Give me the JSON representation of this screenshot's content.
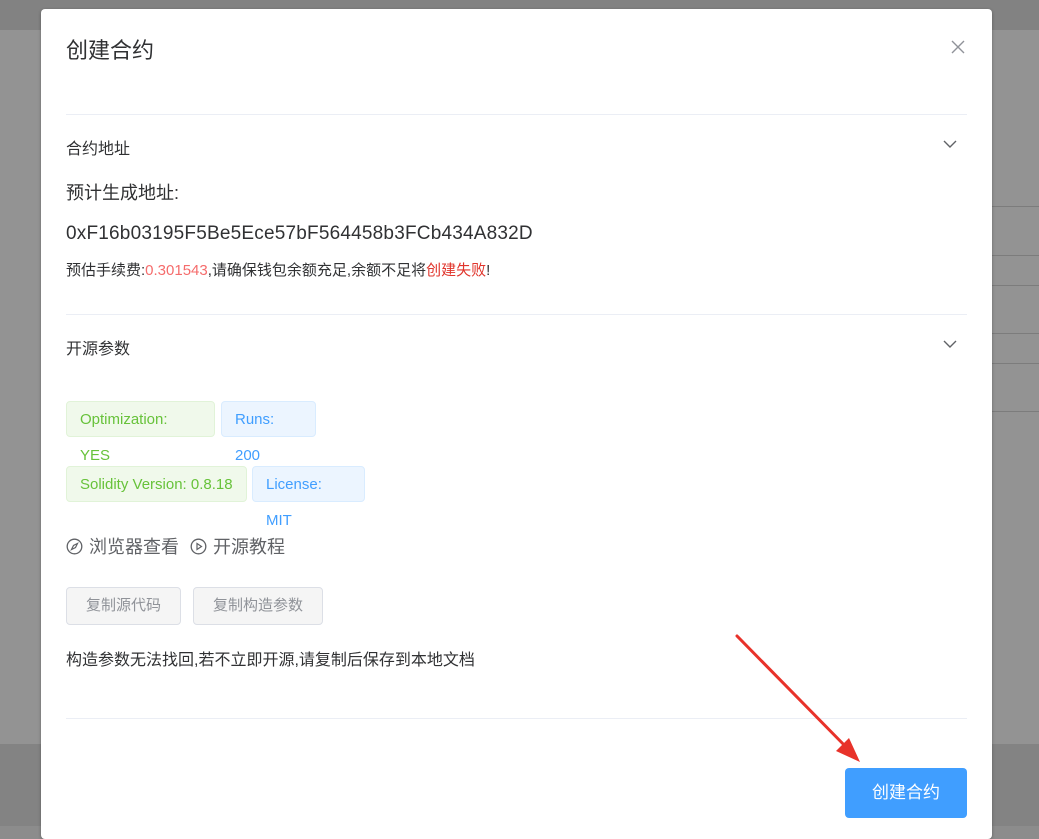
{
  "dialog": {
    "title": "创建合约",
    "close_icon": "close-icon"
  },
  "contract_address": {
    "section_title": "合约地址",
    "expected_label": "预计生成地址:",
    "address": "0xF16b03195F5Be5Ece57bF564458b3FCb434A832D",
    "fee_prefix": "预估手续费:",
    "fee_value": "0.301543",
    "fee_mid": ",请确保钱包余额充足,余额不足将",
    "fee_fail": "创建失败",
    "fee_suffix": "!"
  },
  "open_source": {
    "section_title": "开源参数",
    "tags": {
      "optimization": "Optimization: YES",
      "runs": "Runs: 200",
      "solidity": "Solidity Version: 0.8.18",
      "license": "License: MIT"
    },
    "browser_link": "浏览器查看",
    "tutorial_link": "开源教程",
    "copy_source_button": "复制源代码",
    "copy_params_button": "复制构造参数",
    "note": "构造参数无法找回,若不立即开源,请复制后保存到本地文档"
  },
  "footer": {
    "create_button": "创建合约"
  },
  "colors": {
    "primary": "#409eff",
    "danger": "#f56c6c",
    "success": "#67c23a",
    "annotation_arrow": "#e8322a"
  }
}
